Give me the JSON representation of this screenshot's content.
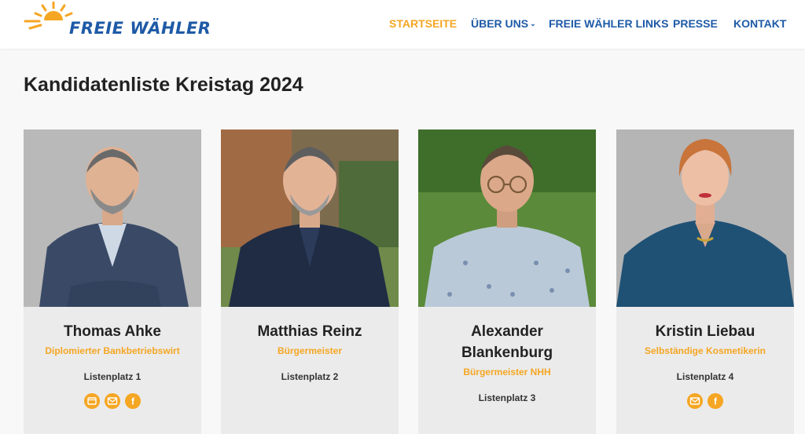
{
  "brand": {
    "name": "FREIE WÄHLER",
    "accent": "#f5a623",
    "primary": "#1e5aa6"
  },
  "nav": {
    "items": [
      {
        "label": "STARTSEITE",
        "active": true
      },
      {
        "label": "ÜBER UNS",
        "has_dropdown": true
      },
      {
        "label": "FREIE WÄHLER LINKS"
      },
      {
        "label": "PRESSE"
      },
      {
        "label": "KONTAKT"
      }
    ]
  },
  "page": {
    "title": "Kandidatenliste Kreistag 2024"
  },
  "candidates": [
    {
      "name": "Thomas Ahke",
      "role": "Diplomierter Bankbetriebswirt",
      "rank": "Listenplatz 1",
      "icons": [
        "website-icon",
        "email-icon",
        "facebook-icon"
      ]
    },
    {
      "name": "Matthias Reinz",
      "role": "Bürgermeister",
      "rank": "Listenplatz 2",
      "icons": []
    },
    {
      "name": "Alexander Blankenburg",
      "role": "Bürgermeister NHH",
      "rank": "Listenplatz 3",
      "icons": []
    },
    {
      "name": "Kristin Liebau",
      "role": "Selbständige Kosmetikerin",
      "rank": "Listenplatz 4",
      "icons": [
        "email-icon",
        "facebook-icon"
      ]
    }
  ]
}
